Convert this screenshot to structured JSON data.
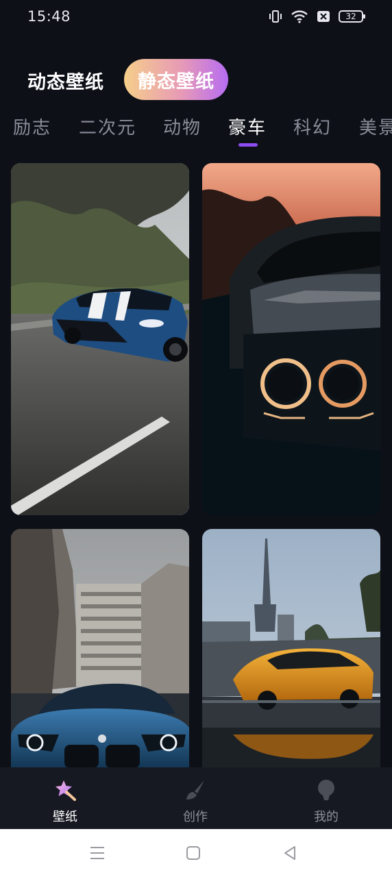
{
  "status_bar": {
    "time": "15:48",
    "battery": "32",
    "icons": [
      "vibrate-icon",
      "wifi-icon",
      "sim-off-icon",
      "battery-icon"
    ]
  },
  "header": {
    "dynamic_label": "动态壁纸",
    "static_label": "静态壁纸",
    "active": "static"
  },
  "categories": {
    "items": [
      "励志",
      "二次元",
      "动物",
      "豪车",
      "科幻",
      "美景"
    ],
    "active_index": 3,
    "accent_color": "#8c4cf0"
  },
  "wallpapers": [
    {
      "subject": "blue muscle car on a motion-blurred road"
    },
    {
      "subject": "dark car front with glowing headlights at sunset"
    },
    {
      "subject": "blue BMW on a city street with buildings"
    },
    {
      "subject": "orange Lamborghini in front of a skyline tower"
    }
  ],
  "bottom_nav": {
    "items": [
      {
        "label": "壁纸",
        "icon": "magic-wand-star-icon",
        "active": true
      },
      {
        "label": "创作",
        "icon": "paint-brush-icon",
        "active": false
      },
      {
        "label": "我的",
        "icon": "profile-icon",
        "active": false
      }
    ]
  },
  "system_nav": {
    "icons": [
      "menu-icon",
      "home-icon",
      "back-icon"
    ]
  }
}
